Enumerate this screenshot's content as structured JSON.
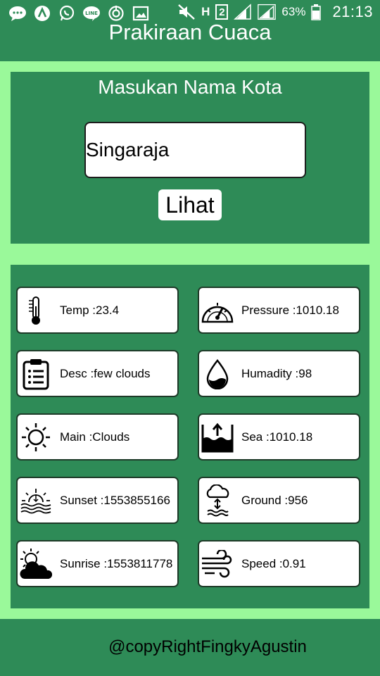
{
  "status_bar": {
    "battery_percent": "63%",
    "sim_label": "2",
    "network_label": "H",
    "time": "21:13",
    "icons": [
      "messages-icon",
      "app-a-icon",
      "whatsapp-icon",
      "line-icon",
      "sync-icon",
      "gallery-icon",
      "mute-icon",
      "network-h-icon",
      "sim-2-icon",
      "signal-icon",
      "signal-icon",
      "battery-icon"
    ]
  },
  "header": {
    "title": "Prakiraan Cuaca"
  },
  "city": {
    "label": "Masukan Nama Kota",
    "input_value": "Singaraja",
    "button_label": "Lihat"
  },
  "weather": {
    "temp": "Temp :23.4",
    "pressure": "Pressure :1010.18",
    "desc": "Desc :few clouds",
    "humidity": "Humadity :98",
    "main": "Main :Clouds",
    "sea": "Sea :1010.18",
    "sunset": "Sunset :1553855166",
    "ground": "Ground :956",
    "sunrise": "Sunrise :1553811778",
    "speed": "Speed :0.91"
  },
  "footer": {
    "credit": "@copyRightFingkyAgustin"
  },
  "colors": {
    "primary": "#2E8B57",
    "background": "#9AF99A",
    "card": "#FFFFFF",
    "text_light": "#FFFFFF",
    "text_dark": "#000000"
  }
}
